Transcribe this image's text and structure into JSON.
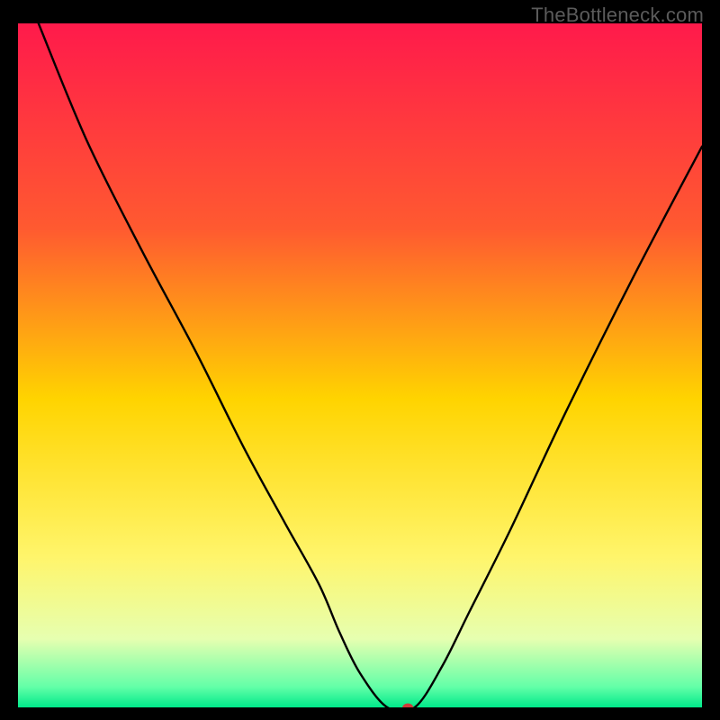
{
  "watermark": "TheBottleneck.com",
  "chart_data": {
    "type": "line",
    "title": "",
    "xlabel": "",
    "ylabel": "",
    "xlim": [
      0,
      100
    ],
    "ylim": [
      0,
      100
    ],
    "background_gradient": {
      "stops": [
        {
          "offset": 0.0,
          "color": "#ff1a4b"
        },
        {
          "offset": 0.3,
          "color": "#ff5a30"
        },
        {
          "offset": 0.55,
          "color": "#ffd400"
        },
        {
          "offset": 0.78,
          "color": "#fff56b"
        },
        {
          "offset": 0.9,
          "color": "#e6ffb0"
        },
        {
          "offset": 0.97,
          "color": "#63ffa8"
        },
        {
          "offset": 1.0,
          "color": "#00e98a"
        }
      ]
    },
    "series": [
      {
        "name": "bottleneck-curve",
        "color": "#000000",
        "x": [
          3,
          10,
          18,
          26,
          33,
          39,
          44,
          47,
          50,
          54,
          58,
          62,
          66,
          72,
          80,
          90,
          100
        ],
        "y": [
          100,
          83,
          67,
          52,
          38,
          27,
          18,
          11,
          5,
          0,
          0,
          6,
          14,
          26,
          43,
          63,
          82
        ]
      }
    ],
    "marker": {
      "name": "optimal-marker",
      "x": 57,
      "y": 0,
      "rx": 6,
      "ry": 4.5,
      "color": "#cf3a3a"
    }
  }
}
